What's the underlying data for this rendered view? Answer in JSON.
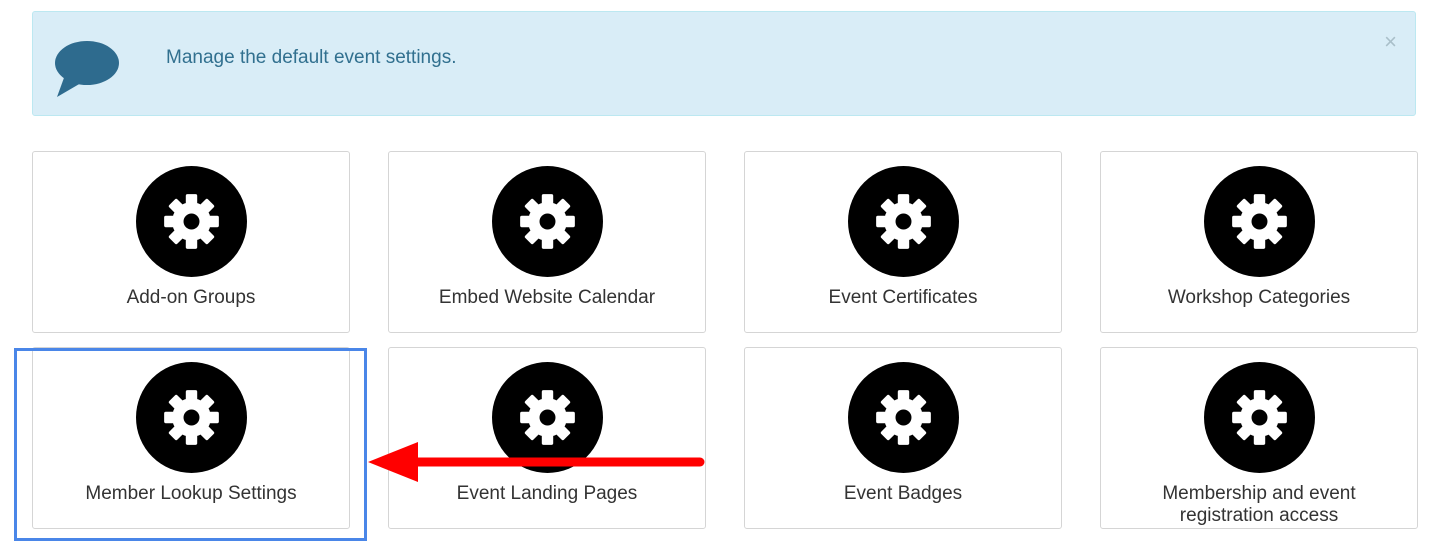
{
  "alert": {
    "message": "Manage the default event settings.",
    "close_symbol": "×",
    "icon": "speech-bubble-icon",
    "background_color": "#d9edf7",
    "text_color": "#31708f"
  },
  "tiles": [
    {
      "label": "Add-on Groups",
      "icon": "gear-icon"
    },
    {
      "label": "Embed Website Calendar",
      "icon": "gear-icon"
    },
    {
      "label": "Event Certificates",
      "icon": "gear-icon"
    },
    {
      "label": "Workshop Categories",
      "icon": "gear-icon"
    },
    {
      "label": "Member Lookup Settings",
      "icon": "gear-icon"
    },
    {
      "label": "Event Landing Pages",
      "icon": "gear-icon"
    },
    {
      "label": "Event Badges",
      "icon": "gear-icon"
    },
    {
      "label": "Membership and event registration access",
      "icon": "gear-icon"
    }
  ],
  "annotation": {
    "highlighted_tile": "Member Lookup Settings",
    "highlight_color": "#4a86e8",
    "arrow_color": "#ff0000"
  }
}
